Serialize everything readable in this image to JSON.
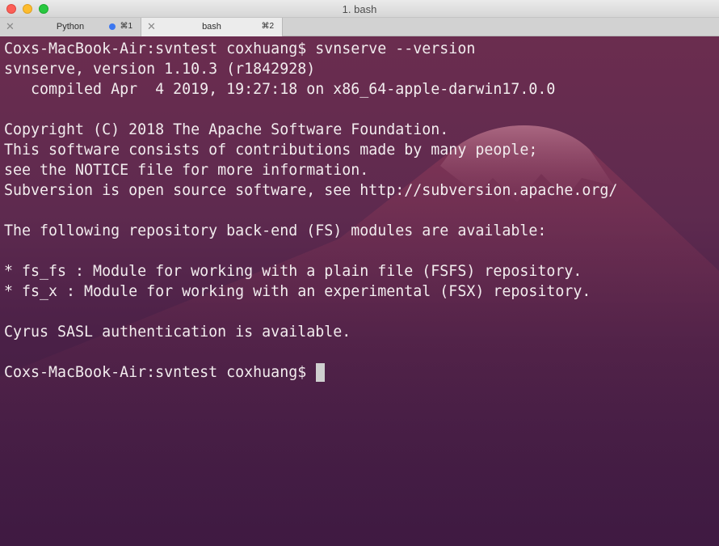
{
  "window": {
    "title": "1. bash",
    "tabs": [
      {
        "label": "Python",
        "shortcut": "⌘1",
        "close": "✕",
        "has_activity_dot": true
      },
      {
        "label": "bash",
        "shortcut": "⌘2",
        "close": "✕",
        "has_activity_dot": false
      }
    ]
  },
  "colors": {
    "close": "#fc5f57",
    "minimize": "#fdbc2e",
    "zoom": "#28c840",
    "activity_dot": "#3c77f0",
    "terminal_text": "#f2ecee"
  },
  "terminal": {
    "lines": [
      "Coxs-MacBook-Air:svntest coxhuang$ svnserve --version",
      "svnserve, version 1.10.3 (r1842928)",
      "   compiled Apr  4 2019, 19:27:18 on x86_64-apple-darwin17.0.0",
      "",
      "Copyright (C) 2018 The Apache Software Foundation.",
      "This software consists of contributions made by many people;",
      "see the NOTICE file for more information.",
      "Subversion is open source software, see http://subversion.apache.org/",
      "",
      "The following repository back-end (FS) modules are available:",
      "",
      "* fs_fs : Module for working with a plain file (FSFS) repository.",
      "* fs_x : Module for working with an experimental (FSX) repository.",
      "",
      "Cyrus SASL authentication is available.",
      ""
    ],
    "prompt": "Coxs-MacBook-Air:svntest coxhuang$ "
  }
}
